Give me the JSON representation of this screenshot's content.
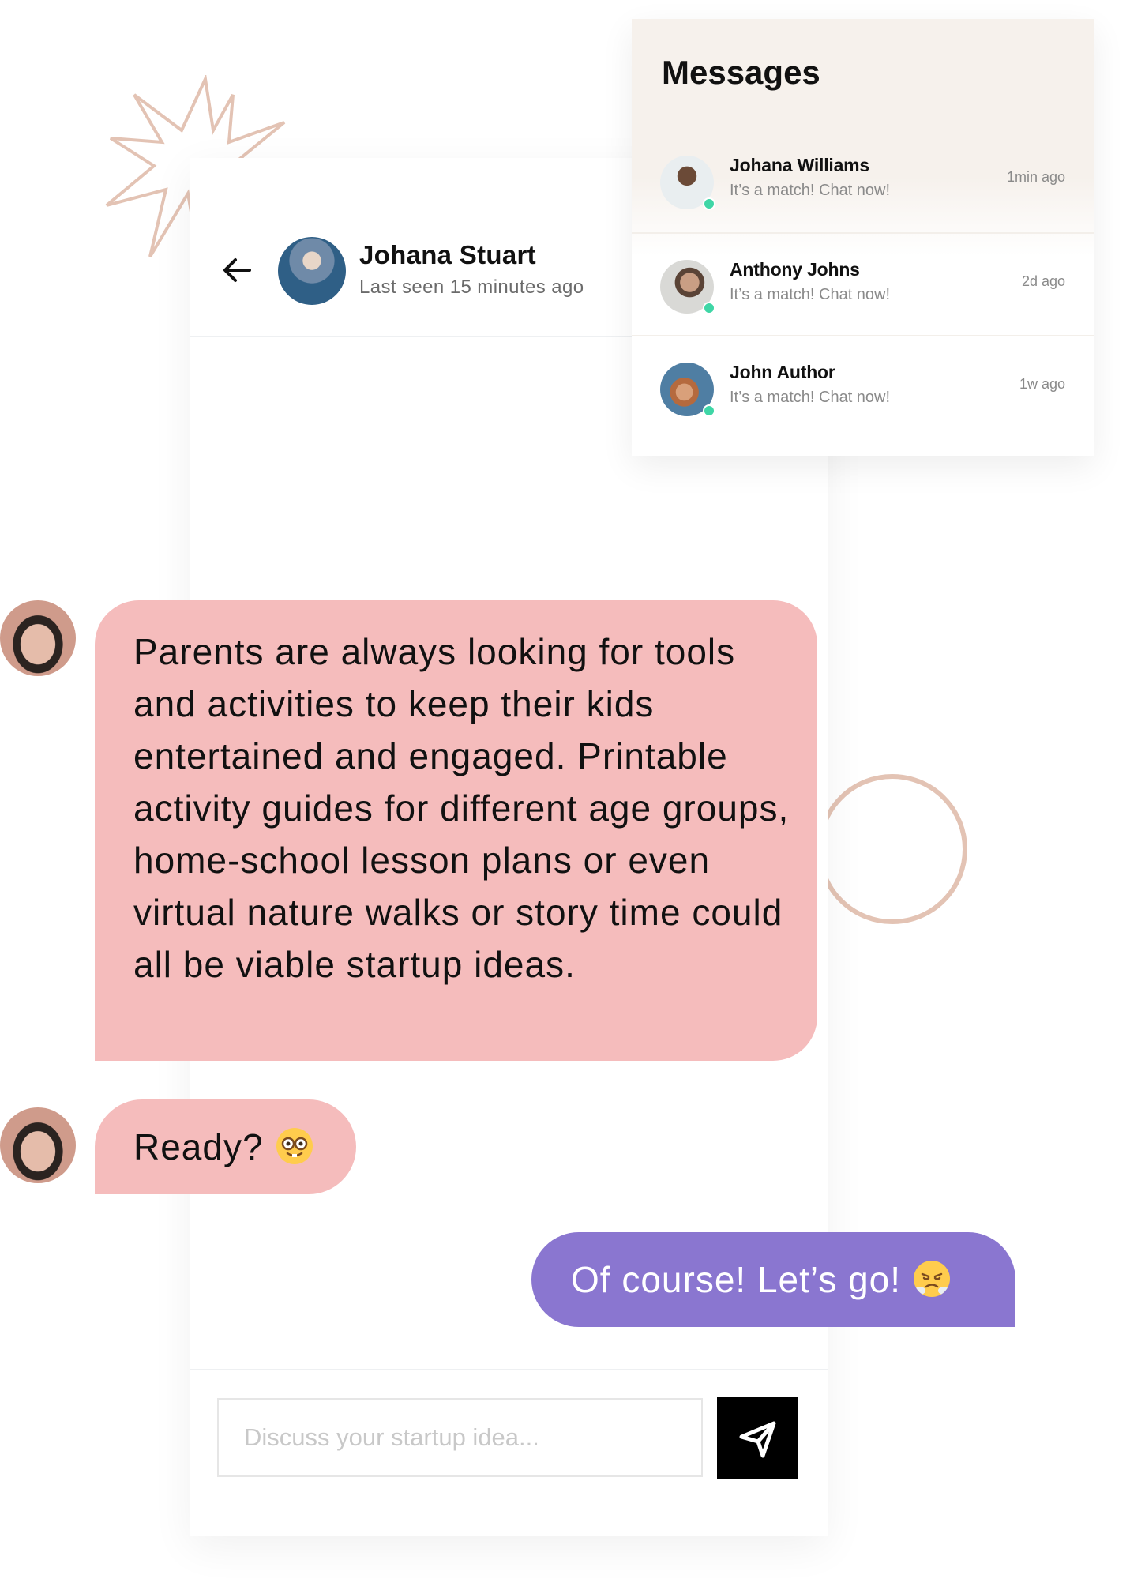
{
  "chat": {
    "header": {
      "name": "Johana Stuart",
      "status": "Last seen 15 minutes ago",
      "back_icon": "arrow-left-icon"
    },
    "messages": [
      {
        "from": "them",
        "text": "Parents are always looking for tools and activities to keep their kids entertained and engaged. Printable activity guides for different age groups, home-school lesson plans or even virtual nature walks or story time could all be viable startup ideas."
      },
      {
        "from": "them",
        "text": "Ready?",
        "emoji": "nerd-face-emoji"
      },
      {
        "from": "me",
        "text": "Of course! Let’s go!",
        "emoji": "face-with-steam-emoji"
      }
    ],
    "composer": {
      "placeholder": "Discuss your startup idea...",
      "send_icon": "send-icon"
    }
  },
  "messages_panel": {
    "title": "Messages",
    "items": [
      {
        "name": "Johana Williams",
        "preview": "It’s a match! Chat now!",
        "time": "1min ago",
        "online": true
      },
      {
        "name": "Anthony Johns",
        "preview": "It’s a match! Chat now!",
        "time": "2d ago",
        "online": true
      },
      {
        "name": "John Author",
        "preview": "It’s a match! Chat now!",
        "time": "1w ago",
        "online": true
      }
    ]
  },
  "colors": {
    "incoming_bubble": "#f5bcbc",
    "outgoing_bubble": "#8a76d0",
    "accent_decor": "#e3c3b4",
    "online": "#3fd6a6",
    "panel_bg": "#f6f1ec"
  }
}
